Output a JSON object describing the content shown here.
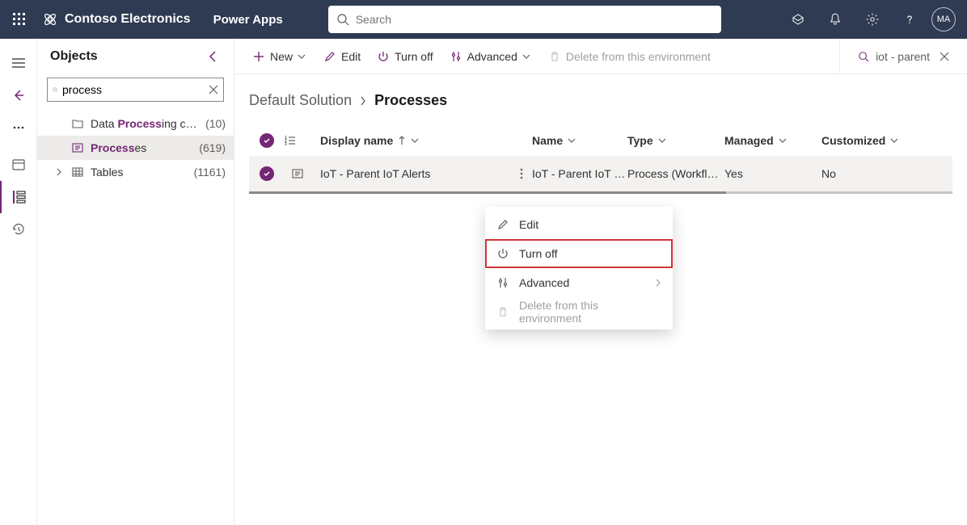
{
  "header": {
    "brand": "Contoso Electronics",
    "app": "Power Apps",
    "search_placeholder": "Search",
    "avatar": "MA"
  },
  "objects": {
    "title": "Objects",
    "search_value": "process",
    "tree": [
      {
        "label_pre": "Data ",
        "label_hl": "Process",
        "label_post": "ing con…",
        "count": "(10)"
      },
      {
        "label_pre": "",
        "label_hl": "Process",
        "label_post": "es",
        "count": "(619)"
      },
      {
        "label_pre": "Tables",
        "label_hl": "",
        "label_post": "",
        "count": "(1161)"
      }
    ]
  },
  "commandbar": {
    "new": "New",
    "edit": "Edit",
    "turnoff": "Turn off",
    "advanced": "Advanced",
    "delete": "Delete from this environment",
    "filter_text": "iot - parent"
  },
  "breadcrumb": {
    "parent": "Default Solution",
    "current": "Processes"
  },
  "grid": {
    "headers": {
      "display_name": "Display name",
      "name": "Name",
      "type": "Type",
      "managed": "Managed",
      "customized": "Customized"
    },
    "rows": [
      {
        "display_name": "IoT - Parent IoT Alerts",
        "name": "IoT - Parent IoT …",
        "type": "Process (Workflo…",
        "managed": "Yes",
        "customized": "No"
      }
    ]
  },
  "context_menu": {
    "edit": "Edit",
    "turn_off": "Turn off",
    "advanced": "Advanced",
    "delete": "Delete from this environment"
  }
}
